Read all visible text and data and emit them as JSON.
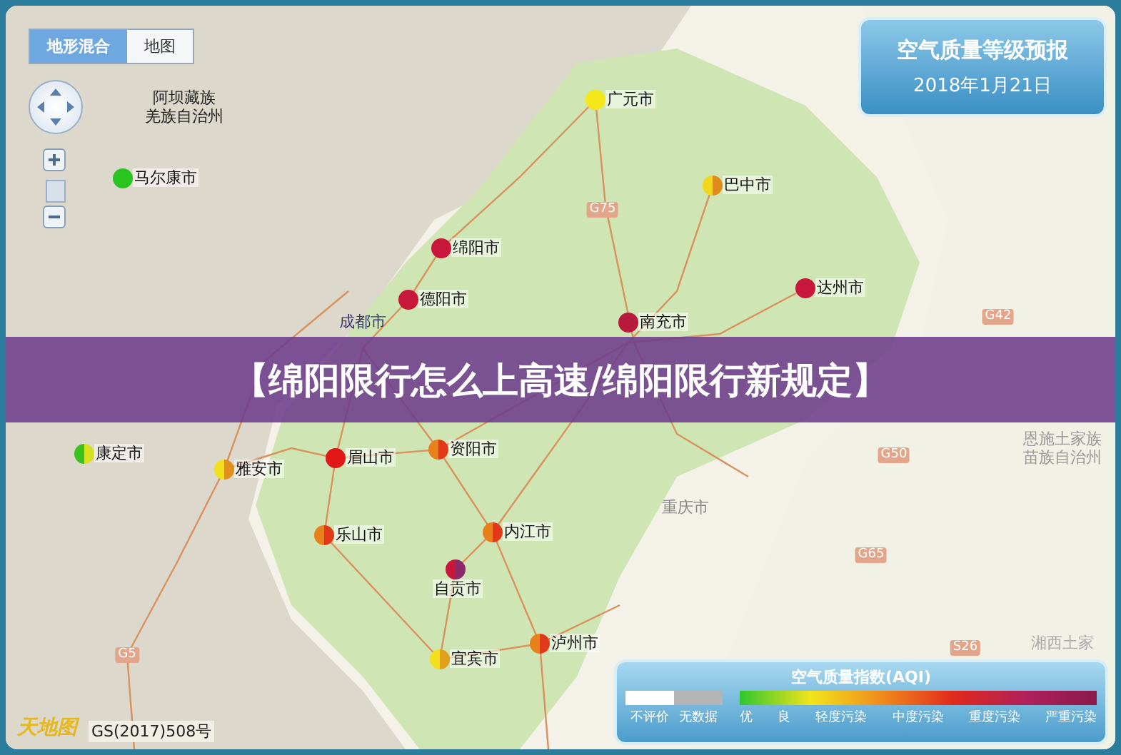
{
  "view_tabs": [
    {
      "label": "地形混合",
      "selected": true
    },
    {
      "label": "地图",
      "selected": false
    }
  ],
  "forecast_panel": {
    "title": "空气质量等级预报",
    "date": "2018年1月21日"
  },
  "region_labels": [
    {
      "lines": [
        "阿坝藏族",
        "羌族自治州"
      ]
    },
    {
      "lines": [
        "成都市"
      ]
    },
    {
      "lines": [
        "重庆市"
      ]
    },
    {
      "lines": [
        "恩施土家族",
        "苗族自治州"
      ]
    },
    {
      "lines": [
        "湘西土家"
      ]
    }
  ],
  "road_shields": [
    "G75",
    "G42",
    "G50",
    "G65",
    "S26",
    "G5"
  ],
  "cities": [
    {
      "name": "广元市",
      "halves": [
        {
          "color": "#f5e81a"
        }
      ]
    },
    {
      "name": "马尔康市",
      "halves": [
        {
          "color": "#2ac41e"
        }
      ]
    },
    {
      "name": "巴中市",
      "halves": [
        {
          "color": "#f2d81c"
        },
        {
          "color": "#e08a1c"
        }
      ]
    },
    {
      "name": "绵阳市",
      "halves": [
        {
          "color": "#c8173a"
        }
      ]
    },
    {
      "name": "达州市",
      "halves": [
        {
          "color": "#c8173a"
        }
      ]
    },
    {
      "name": "德阳市",
      "halves": [
        {
          "color": "#c8173a"
        }
      ]
    },
    {
      "name": "南充市",
      "halves": [
        {
          "color": "#b81a3c"
        }
      ]
    },
    {
      "name": "康定市",
      "halves": [
        {
          "color": "#3cc21e"
        },
        {
          "color": "#d8e020"
        }
      ]
    },
    {
      "name": "雅安市",
      "halves": [
        {
          "color": "#f2e01c"
        },
        {
          "color": "#e0901c"
        }
      ]
    },
    {
      "name": "眉山市",
      "halves": [
        {
          "color": "#e01818"
        }
      ]
    },
    {
      "name": "资阳市",
      "halves": [
        {
          "color": "#e8801c"
        },
        {
          "color": "#e03a18"
        }
      ]
    },
    {
      "name": "乐山市",
      "halves": [
        {
          "color": "#e8801c"
        },
        {
          "color": "#e03a18"
        }
      ]
    },
    {
      "name": "内江市",
      "halves": [
        {
          "color": "#e8801c"
        },
        {
          "color": "#e03a18"
        }
      ]
    },
    {
      "name": "自贡市",
      "halves": [
        {
          "color": "#c8173a"
        },
        {
          "color": "#8a2a6a"
        }
      ]
    },
    {
      "name": "宜宾市",
      "halves": [
        {
          "color": "#f2e01c"
        },
        {
          "color": "#e0a01c"
        }
      ]
    },
    {
      "name": "泸州市",
      "halves": [
        {
          "color": "#e8801c"
        },
        {
          "color": "#e03a18"
        }
      ]
    }
  ],
  "banner": {
    "title": "【绵阳限行怎么上高速/绵阳限行新规定】"
  },
  "attribution": {
    "logo": "天地图",
    "license": "GS(2017)508号"
  },
  "legend": {
    "title": "空气质量指数(AQI)",
    "swatches": [
      {
        "label": "不评价",
        "color": "#ffffff"
      },
      {
        "label": "无数据",
        "color": "#b4b4b4"
      }
    ],
    "scale_labels": [
      "优",
      "良",
      "轻度污染",
      "中度污染",
      "重度污染",
      "严重污染"
    ]
  }
}
